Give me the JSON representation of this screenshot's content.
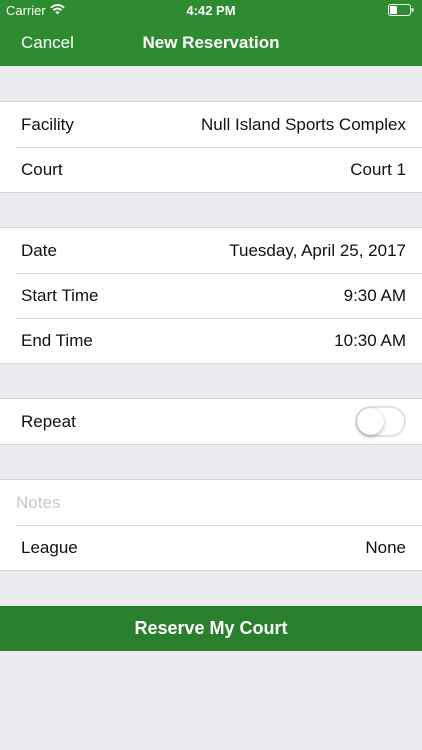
{
  "status_bar": {
    "carrier": "Carrier",
    "time": "4:42 PM"
  },
  "nav": {
    "cancel_label": "Cancel",
    "title": "New Reservation"
  },
  "location": {
    "facility_label": "Facility",
    "facility_value": "Null Island Sports Complex",
    "court_label": "Court",
    "court_value": "Court 1"
  },
  "schedule": {
    "date_label": "Date",
    "date_value": "Tuesday, April 25, 2017",
    "start_label": "Start Time",
    "start_value": "9:30 AM",
    "end_label": "End Time",
    "end_value": "10:30 AM"
  },
  "repeat": {
    "label": "Repeat",
    "enabled": false
  },
  "extras": {
    "notes_placeholder": "Notes",
    "notes_value": "",
    "league_label": "League",
    "league_value": "None"
  },
  "actions": {
    "reserve_label": "Reserve My Court"
  },
  "colors": {
    "brand_green": "#2e8b30",
    "button_green": "#2a7f2c",
    "background": "#ebebf0"
  },
  "icons": {
    "wifi": "wifi-icon",
    "battery": "battery-icon"
  }
}
